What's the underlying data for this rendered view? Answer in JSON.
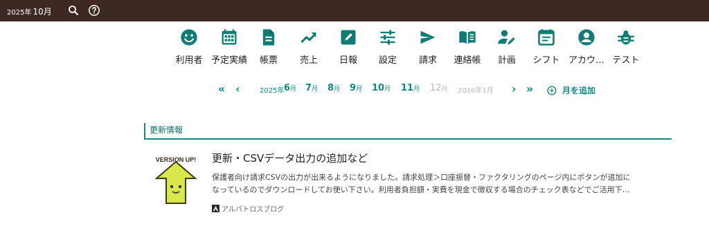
{
  "header": {
    "year": "2025年",
    "month": "10月",
    "search_icon": "search-icon",
    "help_icon": "help-icon"
  },
  "nav": {
    "items": [
      {
        "label": "利用者",
        "icon": "smiley-icon"
      },
      {
        "label": "予定実績",
        "icon": "calendar-icon"
      },
      {
        "label": "帳票",
        "icon": "document-icon"
      },
      {
        "label": "売上",
        "icon": "trending-up-icon"
      },
      {
        "label": "日報",
        "icon": "edit-icon"
      },
      {
        "label": "設定",
        "icon": "sliders-icon"
      },
      {
        "label": "請求",
        "icon": "send-icon"
      },
      {
        "label": "連絡帳",
        "icon": "book-icon"
      },
      {
        "label": "計画",
        "icon": "person-edit-icon"
      },
      {
        "label": "シフト",
        "icon": "event-note-icon"
      },
      {
        "label": "アカウ…",
        "icon": "account-icon"
      },
      {
        "label": "テスト",
        "icon": "bug-icon"
      }
    ]
  },
  "months": {
    "start_year": "2025年",
    "items": [
      {
        "num": "6",
        "unit": "月"
      },
      {
        "num": "7",
        "unit": "月"
      },
      {
        "num": "8",
        "unit": "月"
      },
      {
        "num": "9",
        "unit": "月"
      },
      {
        "num": "10",
        "unit": "月"
      },
      {
        "num": "11",
        "unit": "月"
      },
      {
        "num": "12",
        "unit": "月"
      }
    ],
    "end_year": "2026年1月",
    "add_label": "月を追加"
  },
  "news": {
    "header": "更新情報",
    "title": "更新・CSVデータ出力の追加など",
    "desc_line1": "保護者向け請求CSVの出力が出来るようになりました。請求処理＞口座振替・ファクタリングのページ内にボタンが追加に",
    "desc_line2": "なっているのでダウンロードしてお使い下さい。利用者負担額・実費を現金で徴収する場合のチェック表などでご活用下…",
    "thumb_text": "VERSION UP!",
    "source": "アルバトロスブログ"
  },
  "colors": {
    "topbar": "#3d2822",
    "accent": "#0e8a80",
    "icon": "#0f7d74"
  }
}
